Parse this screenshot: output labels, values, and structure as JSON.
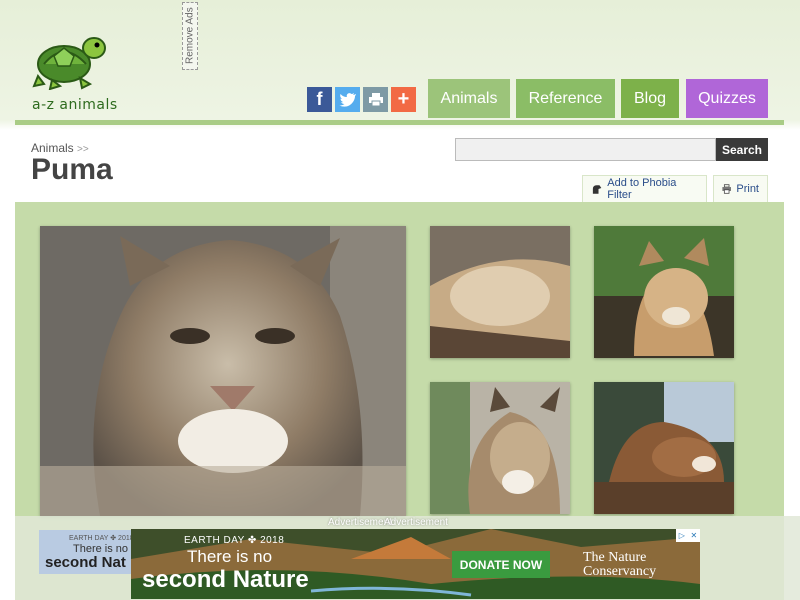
{
  "brand": {
    "name": "a-z animals",
    "remove_ads": "Remove Ads"
  },
  "share": {
    "facebook": "f",
    "plus": "+"
  },
  "nav": {
    "tabs": [
      "Animals",
      "Reference",
      "Blog",
      "Quizzes"
    ]
  },
  "breadcrumb": {
    "parent": "Animals",
    "separator": ">>"
  },
  "page": {
    "title": "Puma"
  },
  "search": {
    "placeholder": "",
    "button": "Search"
  },
  "tools": {
    "phobia": "Add to Phobia Filter",
    "print": "Print"
  },
  "ads": {
    "label": "Advertisement",
    "small": {
      "line1": "EARTH DAY ✤ 2018",
      "line2": "There is no",
      "line3": "second Nat"
    },
    "banner": {
      "line1": "EARTH DAY ✤ 2018",
      "line2": "There is no",
      "line3": "second Nature",
      "cta": "DONATE NOW",
      "org_line1": "The Nature",
      "org_line2": "Conservancy"
    }
  },
  "colors": {
    "accent_green": "#9cc47a",
    "quizzes_purple": "#b066d8",
    "gallery_bg": "#c5dba9"
  }
}
